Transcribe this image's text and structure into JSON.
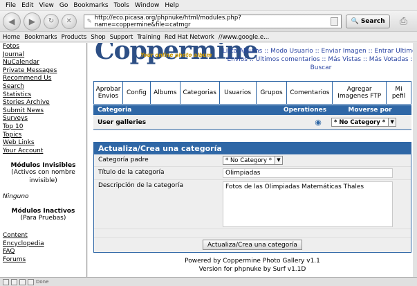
{
  "menu": [
    "File",
    "Edit",
    "View",
    "Go",
    "Bookmarks",
    "Tools",
    "Window",
    "Help"
  ],
  "url": "http://eco.picasa.org/phpnuke/html/modules.php?name=coppermine&file=catmgr",
  "search_label": "Search",
  "bookmarks": [
    "Home",
    "Bookmarks",
    "Products",
    "Shop",
    "Support",
    "Training",
    "Red Hat Network",
    "//www.google.e..."
  ],
  "sidebar": {
    "links": [
      "Fotos",
      "Journal",
      "NuCalendar",
      "Private Messages",
      "Recommend Us",
      "Search",
      "Statistics",
      "Stories Archive",
      "Submit News",
      "Surveys",
      "Top 10",
      "Topics",
      "Web Links",
      "Your Account"
    ],
    "invisible_title": "Módulos Invisibles",
    "invisible_sub": "(Activos con nombre invisible)",
    "invisible_none": "Ninguno",
    "inactive_title": "Módulos Inactivos",
    "inactive_sub": "(Para Pruebas)",
    "bottom_links": [
      "Content",
      "Encyclopedia",
      "FAQ",
      "Forums"
    ]
  },
  "logo": {
    "text": "Coppermine",
    "tagline": "Your online photo album"
  },
  "toplinks": "Lista Albums :: Modo Usuario :: Enviar Imagen :: Entrar Ultimos Envios :: Ultimos comentarios :: Más Vistas :: Más Votadas :: Buscar",
  "tabs": [
    "Aprobar Envios",
    "Config",
    "Albums",
    "Categorias",
    "Usuarios",
    "Grupos",
    "Comentarios",
    "Agregar Imagenes FTP",
    "Mi pefil"
  ],
  "table_header": {
    "col1": "Categoria",
    "col2": "Operationes",
    "col3": "Moverse por"
  },
  "table_row": {
    "name": "User galleries",
    "move_value": "* No Category *"
  },
  "panel": {
    "title": "Actualiza/Crea una categoría",
    "parent_label": "Categoría padre",
    "parent_value": "* No Category *",
    "title_label": "Título de la categoría",
    "title_value": "Olimpiadas",
    "desc_label": "Descripción de la categoría",
    "desc_value": "Fotos de las Olimpiadas Matemáticas Thales",
    "submit": "Actualiza/Crea una categoría"
  },
  "footer": {
    "line1": "Powered by Coppermine Photo Gallery v1.1",
    "line2": "Version for phpnuke by Surf v1.1D"
  },
  "status": "Done"
}
